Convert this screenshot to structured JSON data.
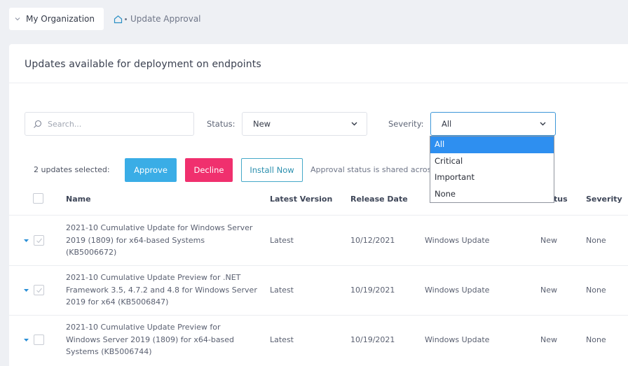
{
  "breadcrumb": {
    "org": "My Organization",
    "page": "Update Approval"
  },
  "card": {
    "title": "Updates available for deployment on endpoints"
  },
  "filters": {
    "search_placeholder": "Search...",
    "status_label": "Status:",
    "status_value": "New",
    "severity_label": "Severity:",
    "severity_value": "All",
    "severity_options": [
      "All",
      "Critical",
      "Important",
      "None"
    ]
  },
  "actions": {
    "selected_text": "2 updates selected:",
    "approve": "Approve",
    "decline": "Decline",
    "install": "Install Now",
    "note": "Approval status is shared across"
  },
  "table": {
    "headers": [
      "Name",
      "Latest Version",
      "Release Date",
      "Status",
      "Severity"
    ],
    "status_header_visible": "tus",
    "rows": [
      {
        "name": "2021-10 Cumulative Update for Windows Server 2019 (1809) for x64-based Systems (KB5006672)",
        "name_lines": [
          "2021-10 Cumulative Update for Windows Server",
          "2019 (1809) for x64-based Systems",
          "(KB5006672)"
        ],
        "version": "Latest",
        "date": "10/12/2021",
        "source": "Windows Update",
        "status": "New",
        "severity": "None",
        "checked": true
      },
      {
        "name": "2021-10 Cumulative Update Preview for .NET Framework 3.5, 4.7.2 and 4.8 for Windows Server 2019 for x64 (KB5006847)",
        "name_lines": [
          "2021-10 Cumulative Update Preview for .NET",
          "Framework 3.5, 4.7.2 and 4.8 for Windows Server",
          "2019 for x64 (KB5006847)"
        ],
        "version": "Latest",
        "date": "10/19/2021",
        "source": "Windows Update",
        "status": "New",
        "severity": "None",
        "checked": true
      },
      {
        "name": "2021-10 Cumulative Update Preview for Windows Server 2019 (1809) for x64-based Systems (KB5006744)",
        "name_lines": [
          "2021-10 Cumulative Update Preview for",
          "Windows Server 2019 (1809) for x64-based",
          "Systems (KB5006744)"
        ],
        "version": "Latest",
        "date": "10/19/2021",
        "source": "Windows Update",
        "status": "New",
        "severity": "None",
        "checked": false
      }
    ]
  },
  "colors": {
    "accent": "#3aade6",
    "decline": "#f0306e",
    "dropdown_selected": "#2e8ff0"
  }
}
